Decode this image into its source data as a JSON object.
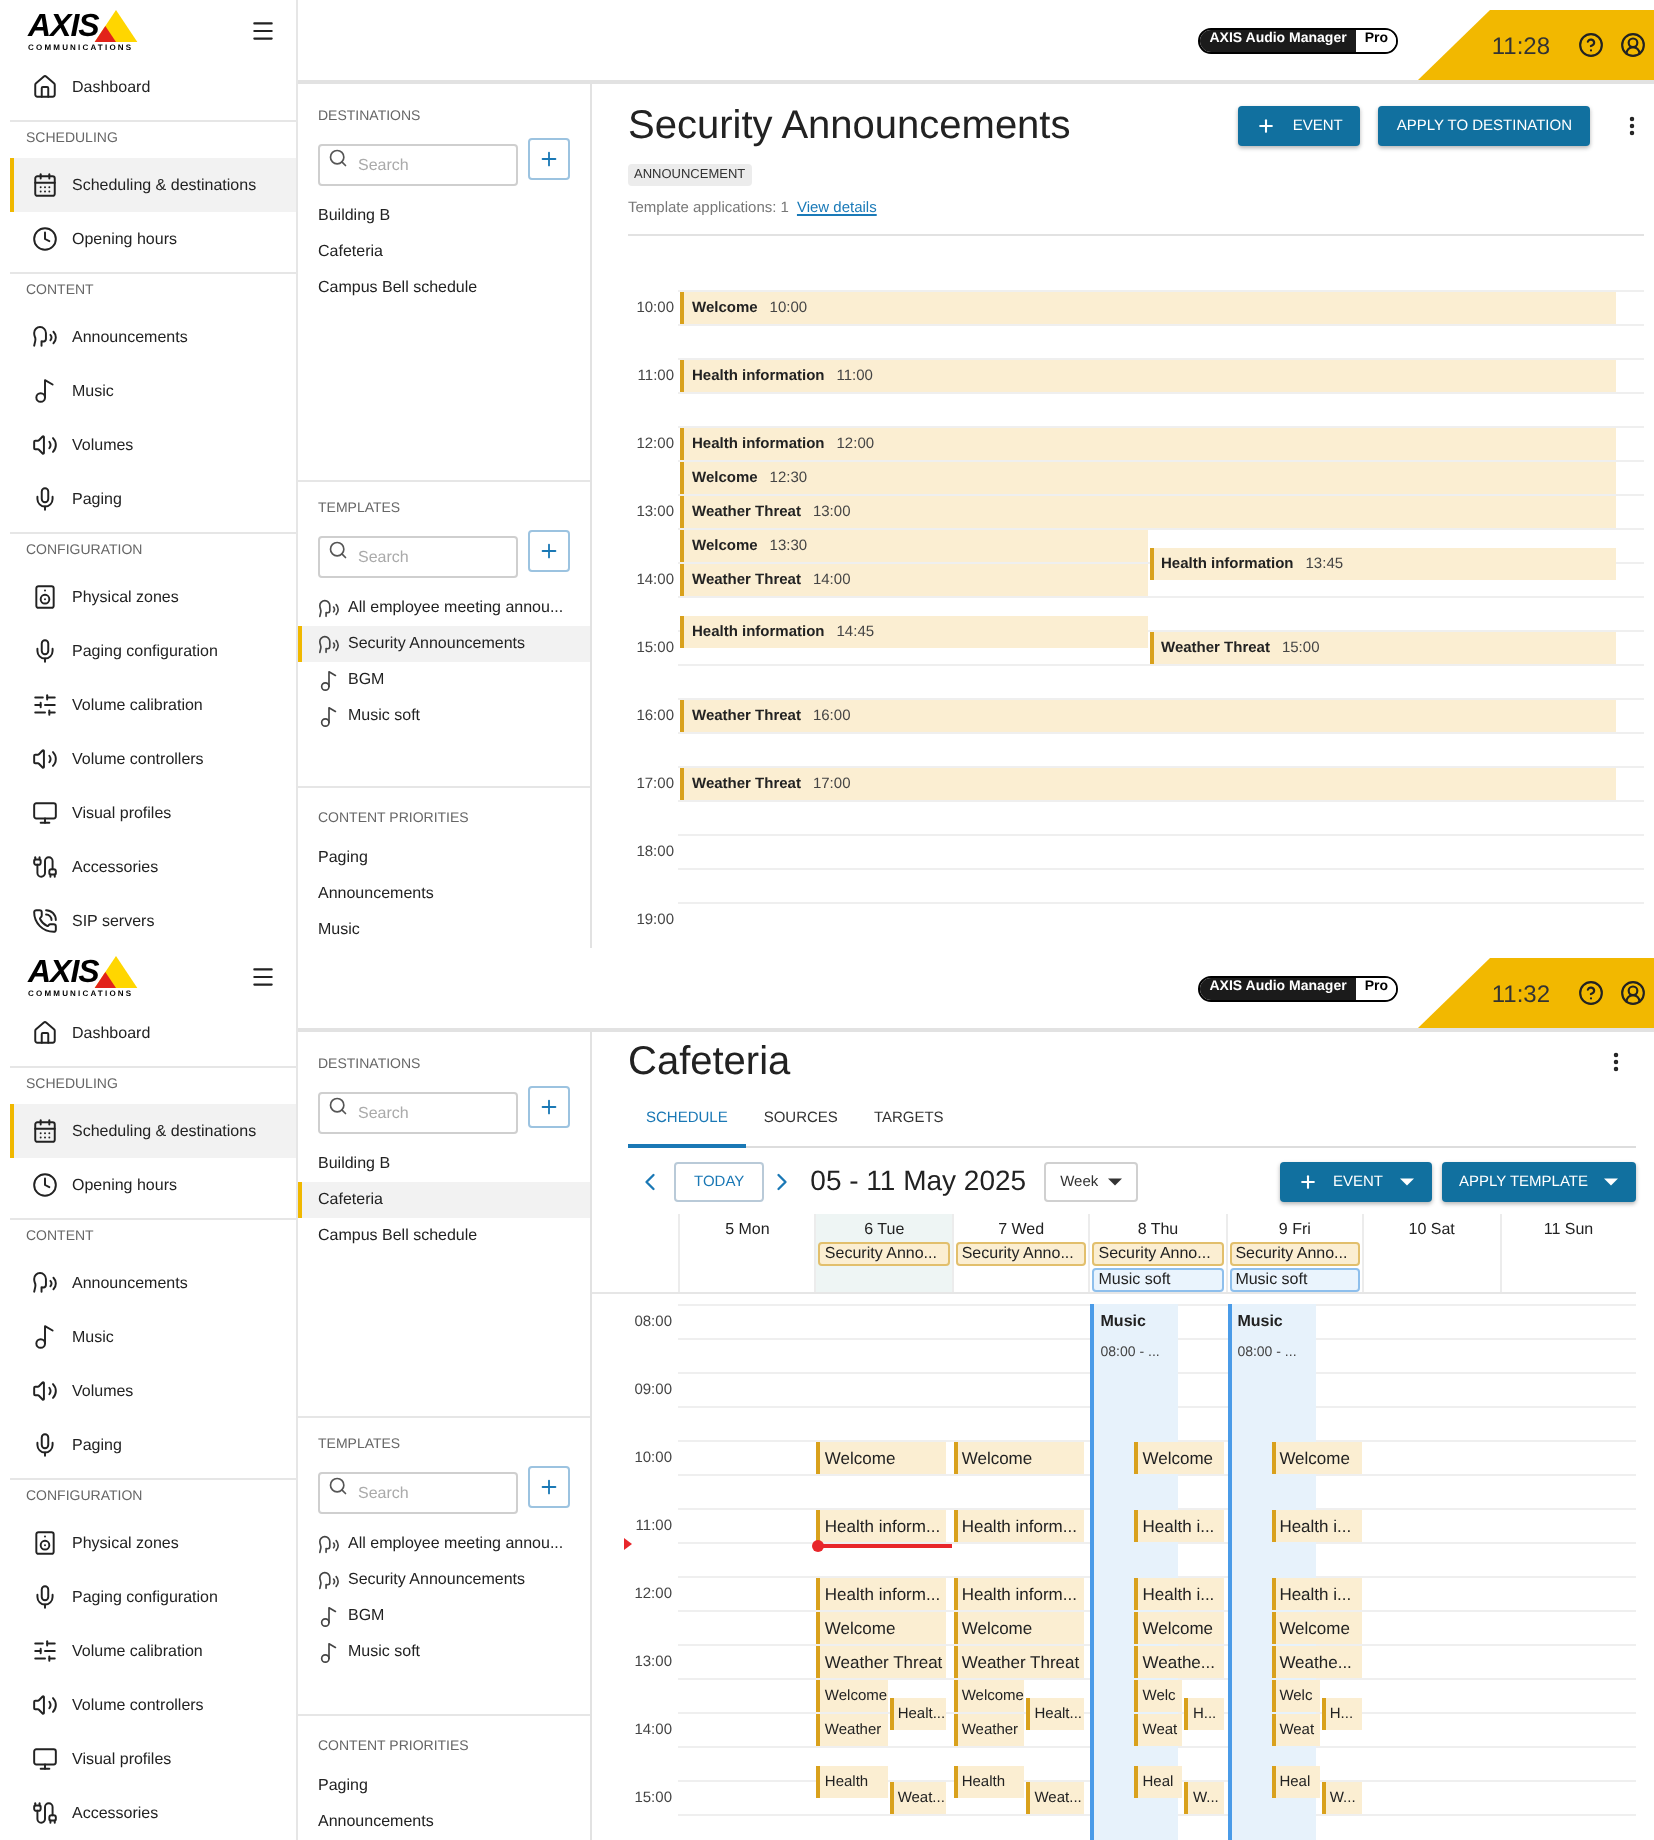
{
  "screens": [
    {
      "header": {
        "logo": "AXIS",
        "logo_sub": "COMMUNICATIONS",
        "product": "AXIS Audio Manager",
        "edition": "Pro",
        "time": "11:28"
      },
      "nav_top": [
        {
          "kind": "home",
          "label": "Dashboard",
          "selected": false
        }
      ],
      "nav_sections": [
        {
          "title": "SCHEDULING",
          "items": [
            {
              "kind": "calendar",
              "label": "Scheduling & destinations",
              "selected": true
            },
            {
              "kind": "clock",
              "label": "Opening hours",
              "selected": false
            }
          ]
        },
        {
          "title": "CONTENT",
          "items": [
            {
              "kind": "announcement",
              "label": "Announcements",
              "selected": false
            },
            {
              "kind": "music",
              "label": "Music",
              "selected": false
            },
            {
              "kind": "volume",
              "label": "Volumes",
              "selected": false
            },
            {
              "kind": "mic",
              "label": "Paging",
              "selected": false
            }
          ]
        },
        {
          "title": "CONFIGURATION",
          "items": [
            {
              "kind": "zone",
              "label": "Physical zones",
              "selected": false
            },
            {
              "kind": "mic",
              "label": "Paging configuration",
              "selected": false
            },
            {
              "kind": "sliders",
              "label": "Volume calibration",
              "selected": false
            },
            {
              "kind": "volume",
              "label": "Volume controllers",
              "selected": false
            },
            {
              "kind": "monitor",
              "label": "Visual profiles",
              "selected": false
            },
            {
              "kind": "cable",
              "label": "Accessories",
              "selected": false
            },
            {
              "kind": "phone",
              "label": "SIP servers",
              "selected": false
            }
          ]
        }
      ],
      "panel": [
        {
          "title": "DESTINATIONS",
          "search": {
            "placeholder": "Search"
          },
          "items": [
            {
              "label": "Building B",
              "selected": false
            },
            {
              "label": "Cafeteria",
              "selected": false
            },
            {
              "label": "Campus Bell schedule",
              "selected": false
            }
          ]
        },
        {
          "title": "TEMPLATES",
          "search": {
            "placeholder": "Search"
          },
          "items": [
            {
              "kind": "announcement",
              "label": "All employee meeting annou...",
              "selected": false
            },
            {
              "kind": "announcement",
              "label": "Security Announcements",
              "selected": true
            },
            {
              "kind": "music",
              "label": "BGM",
              "selected": false
            },
            {
              "kind": "music",
              "label": "Music soft",
              "selected": false
            }
          ]
        },
        {
          "title": "CONTENT PRIORITIES",
          "items": [
            {
              "label": "Paging",
              "selected": false
            },
            {
              "label": "Announcements",
              "selected": false
            },
            {
              "label": "Music",
              "selected": false
            }
          ]
        }
      ],
      "main": {
        "kind": "template",
        "title": "Security Announcements",
        "buttons": [
          {
            "kind": "add",
            "label": "EVENT",
            "menu": false
          },
          {
            "kind": "plain",
            "label": "APPLY TO DESTINATION",
            "menu": false
          }
        ],
        "badge": "ANNOUNCEMENT",
        "applications": "Template applications: 1",
        "link": "View details",
        "time_labels": [
          "10:00",
          "11:00",
          "12:00",
          "13:00",
          "14:00",
          "15:00",
          "16:00",
          "17:00",
          "18:00",
          "19:00"
        ],
        "events": [
          {
            "title": "Welcome",
            "time": "10:00",
            "kind": "full"
          },
          {
            "title": "Health information",
            "time": "11:00",
            "kind": "full"
          },
          {
            "title": "Health information",
            "time": "12:00",
            "kind": "full"
          },
          {
            "title": "Welcome",
            "time": "12:30",
            "kind": "full"
          },
          {
            "title": "Weather Threat",
            "time": "13:00",
            "kind": "full"
          },
          {
            "title": "Welcome",
            "time": "13:30",
            "kind": "left"
          },
          {
            "title": "Health information",
            "time": "13:45",
            "kind": "right"
          },
          {
            "title": "Weather Threat",
            "time": "14:00",
            "kind": "left"
          },
          {
            "title": "Health information",
            "time": "14:45",
            "kind": "left"
          },
          {
            "title": "Weather Threat",
            "time": "15:00",
            "kind": "right"
          },
          {
            "title": "Weather Threat",
            "time": "16:00",
            "kind": "full"
          },
          {
            "title": "Weather Threat",
            "time": "17:00",
            "kind": "full"
          }
        ]
      }
    },
    {
      "header": {
        "logo": "AXIS",
        "logo_sub": "COMMUNICATIONS",
        "product": "AXIS Audio Manager",
        "edition": "Pro",
        "time": "11:32"
      },
      "nav_top": [
        {
          "kind": "home",
          "label": "Dashboard",
          "selected": false
        }
      ],
      "nav_sections": [
        {
          "title": "SCHEDULING",
          "items": [
            {
              "kind": "calendar",
              "label": "Scheduling & destinations",
              "selected": true
            },
            {
              "kind": "clock",
              "label": "Opening hours",
              "selected": false
            }
          ]
        },
        {
          "title": "CONTENT",
          "items": [
            {
              "kind": "announcement",
              "label": "Announcements",
              "selected": false
            },
            {
              "kind": "music",
              "label": "Music",
              "selected": false
            },
            {
              "kind": "volume",
              "label": "Volumes",
              "selected": false
            },
            {
              "kind": "mic",
              "label": "Paging",
              "selected": false
            }
          ]
        },
        {
          "title": "CONFIGURATION",
          "items": [
            {
              "kind": "zone",
              "label": "Physical zones",
              "selected": false
            },
            {
              "kind": "mic",
              "label": "Paging configuration",
              "selected": false
            },
            {
              "kind": "sliders",
              "label": "Volume calibration",
              "selected": false
            },
            {
              "kind": "volume",
              "label": "Volume controllers",
              "selected": false
            },
            {
              "kind": "monitor",
              "label": "Visual profiles",
              "selected": false
            },
            {
              "kind": "cable",
              "label": "Accessories",
              "selected": false
            }
          ]
        }
      ],
      "panel": [
        {
          "title": "DESTINATIONS",
          "search": {
            "placeholder": "Search"
          },
          "items": [
            {
              "label": "Building B",
              "selected": false
            },
            {
              "label": "Cafeteria",
              "selected": true
            },
            {
              "label": "Campus Bell schedule",
              "selected": false
            }
          ]
        },
        {
          "title": "TEMPLATES",
          "search": {
            "placeholder": "Search"
          },
          "items": [
            {
              "kind": "announcement",
              "label": "All employee meeting annou...",
              "selected": false
            },
            {
              "kind": "announcement",
              "label": "Security Announcements",
              "selected": false
            },
            {
              "kind": "music",
              "label": "BGM",
              "selected": false
            },
            {
              "kind": "music",
              "label": "Music soft",
              "selected": false
            }
          ]
        },
        {
          "title": "CONTENT PRIORITIES",
          "items": [
            {
              "label": "Paging",
              "selected": false
            },
            {
              "label": "Announcements",
              "selected": false
            }
          ]
        }
      ],
      "main": {
        "kind": "destination",
        "title": "Cafeteria",
        "tabs": [
          {
            "label": "SCHEDULE",
            "selected": true
          },
          {
            "label": "SOURCES",
            "selected": false
          },
          {
            "label": "TARGETS",
            "selected": false
          }
        ],
        "today": "TODAY",
        "range": "05 - 11 May 2025",
        "view": "Week",
        "buttons": [
          {
            "kind": "add",
            "label": "EVENT",
            "menu": true
          },
          {
            "kind": "plain",
            "label": "APPLY TEMPLATE",
            "menu": true
          }
        ],
        "time_labels": [
          "08:00",
          "09:00",
          "10:00",
          "11:00",
          "12:00",
          "13:00",
          "14:00",
          "15:00"
        ],
        "days": [
          {
            "label": "5 Mon",
            "today": false
          },
          {
            "label": "6 Tue",
            "today": true,
            "allday": [
              {
                "kind": "announcement",
                "title": "Security Anno..."
              }
            ],
            "events": [
              "Welcome",
              "Health inform...",
              "Health inform...",
              "Welcome",
              "Weather Threat",
              "Welcome",
              "Healt...",
              "Weather",
              "Health",
              "Weat..."
            ]
          },
          {
            "label": "7 Wed",
            "today": false,
            "allday": [
              {
                "kind": "announcement",
                "title": "Security Anno..."
              }
            ],
            "events": [
              "Welcome",
              "Health inform...",
              "Health inform...",
              "Welcome",
              "Weather Threat",
              "Welcome",
              "Healt...",
              "Weather",
              "Health",
              "Weat..."
            ]
          },
          {
            "label": "8 Thu",
            "today": false,
            "allday": [
              {
                "kind": "announcement",
                "title": "Security Anno..."
              },
              {
                "kind": "music",
                "title": "Music soft"
              }
            ],
            "band": {
              "title": "Music",
              "time": "08:00 - ..."
            },
            "events": [
              "Welcome",
              "Health i...",
              "Health i...",
              "Welcome",
              "Weathe...",
              "Welc",
              "H...",
              "Weat",
              "Heal",
              "W..."
            ]
          },
          {
            "label": "9 Fri",
            "today": false,
            "allday": [
              {
                "kind": "announcement",
                "title": "Security Anno..."
              },
              {
                "kind": "music",
                "title": "Music soft"
              }
            ],
            "band": {
              "title": "Music",
              "time": "08:00 - ..."
            },
            "events": [
              "Welcome",
              "Health i...",
              "Health i...",
              "Welcome",
              "Weathe...",
              "Welc",
              "H...",
              "Weat",
              "Heal",
              "W..."
            ]
          },
          {
            "label": "10 Sat",
            "today": false
          },
          {
            "label": "11 Sun",
            "today": false
          }
        ]
      }
    }
  ]
}
